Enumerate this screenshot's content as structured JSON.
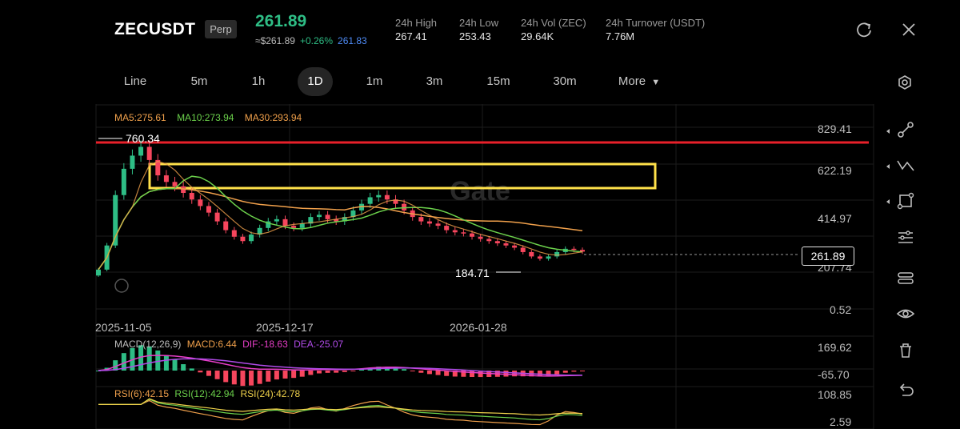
{
  "header": {
    "symbol": "ZECUSDT",
    "contract_badge": "Perp",
    "last_price": "261.89",
    "fiat_price": "≈$261.89",
    "change_pct": "+0.26%",
    "mark_price": "261.83",
    "stats": [
      {
        "label": "24h  High",
        "value": "267.41"
      },
      {
        "label": "24h  Low",
        "value": "253.43"
      },
      {
        "label": "24h  Vol (ZEC)",
        "value": "29.64K"
      },
      {
        "label": "24h  Turnover (USDT)",
        "value": "7.76M"
      }
    ]
  },
  "tabs": {
    "items": [
      "Line",
      "5m",
      "1h",
      "1D",
      "1m",
      "3m",
      "15m",
      "30m"
    ],
    "active": "1D",
    "more_label": "More"
  },
  "chart": {
    "watermark": "Gate",
    "ma": {
      "ma5": "MA5:275.61",
      "ma10": "MA10:273.94",
      "ma30": "MA30:293.94"
    },
    "y_labels": [
      "829.41",
      "622.19",
      "414.97",
      "207.74",
      "0.52"
    ],
    "x_labels": [
      "2025-11-05",
      "2025-12-17",
      "2026-01-28"
    ],
    "current_price_tag": "261.89",
    "high_annotation": "760.34",
    "low_annotation": "184.71",
    "macd": {
      "title": "MACD(12,26,9)",
      "macd": "MACD:6.44",
      "dif": "DIF:-18.63",
      "dea": "DEA:-25.07",
      "y_top": "169.62",
      "y_bottom": "-65.70"
    },
    "rsi": {
      "rsi6": "RSI(6):42.15",
      "rsi12": "RSI(12):42.94",
      "rsi24": "RSI(24):42.78",
      "y_top": "108.85",
      "y_bottom": "2.59"
    },
    "colors": {
      "up": "#2ebd85",
      "down": "#f6465d",
      "ma5": "#f0a04b",
      "ma10": "#6bd04b",
      "ma30": "#f0a04b",
      "alert_line": "#e8202a",
      "box": "#ffe14a",
      "dif": "#e83ec9",
      "dea": "#b04be8"
    }
  },
  "chart_data": {
    "type": "candlestick",
    "title": "ZECUSDT",
    "interval": "1D",
    "x_range": [
      "2025-10-22",
      "2026-02-23"
    ],
    "ylim": [
      0.52,
      829.41
    ],
    "yticks": [
      829.41,
      622.19,
      414.97,
      207.74,
      0.52
    ],
    "series": [
      {
        "name": "ZECUSDT",
        "type": "close",
        "values": [
          180,
          290,
          520,
          640,
          700,
          740,
          680,
          610,
          580,
          560,
          530,
          500,
          470,
          440,
          400,
          360,
          330,
          310,
          340,
          370,
          400,
          410,
          380,
          370,
          390,
          420,
          430,
          410,
          400,
          420,
          450,
          480,
          510,
          520,
          500,
          480,
          450,
          420,
          400,
          390,
          380,
          360,
          350,
          345,
          330,
          320,
          310,
          300,
          290,
          280,
          260,
          240,
          230,
          240,
          260,
          275,
          270,
          262
        ]
      }
    ],
    "indicators": {
      "MA5": 275.61,
      "MA10": 273.94,
      "MA30": 293.94,
      "MACD": 6.44,
      "DIF": -18.63,
      "DEA": -25.07,
      "RSI6": 42.15,
      "RSI12": 42.94,
      "RSI24": 42.78
    },
    "annotations": {
      "high": 760.34,
      "low": 184.71,
      "last": 261.89
    }
  }
}
